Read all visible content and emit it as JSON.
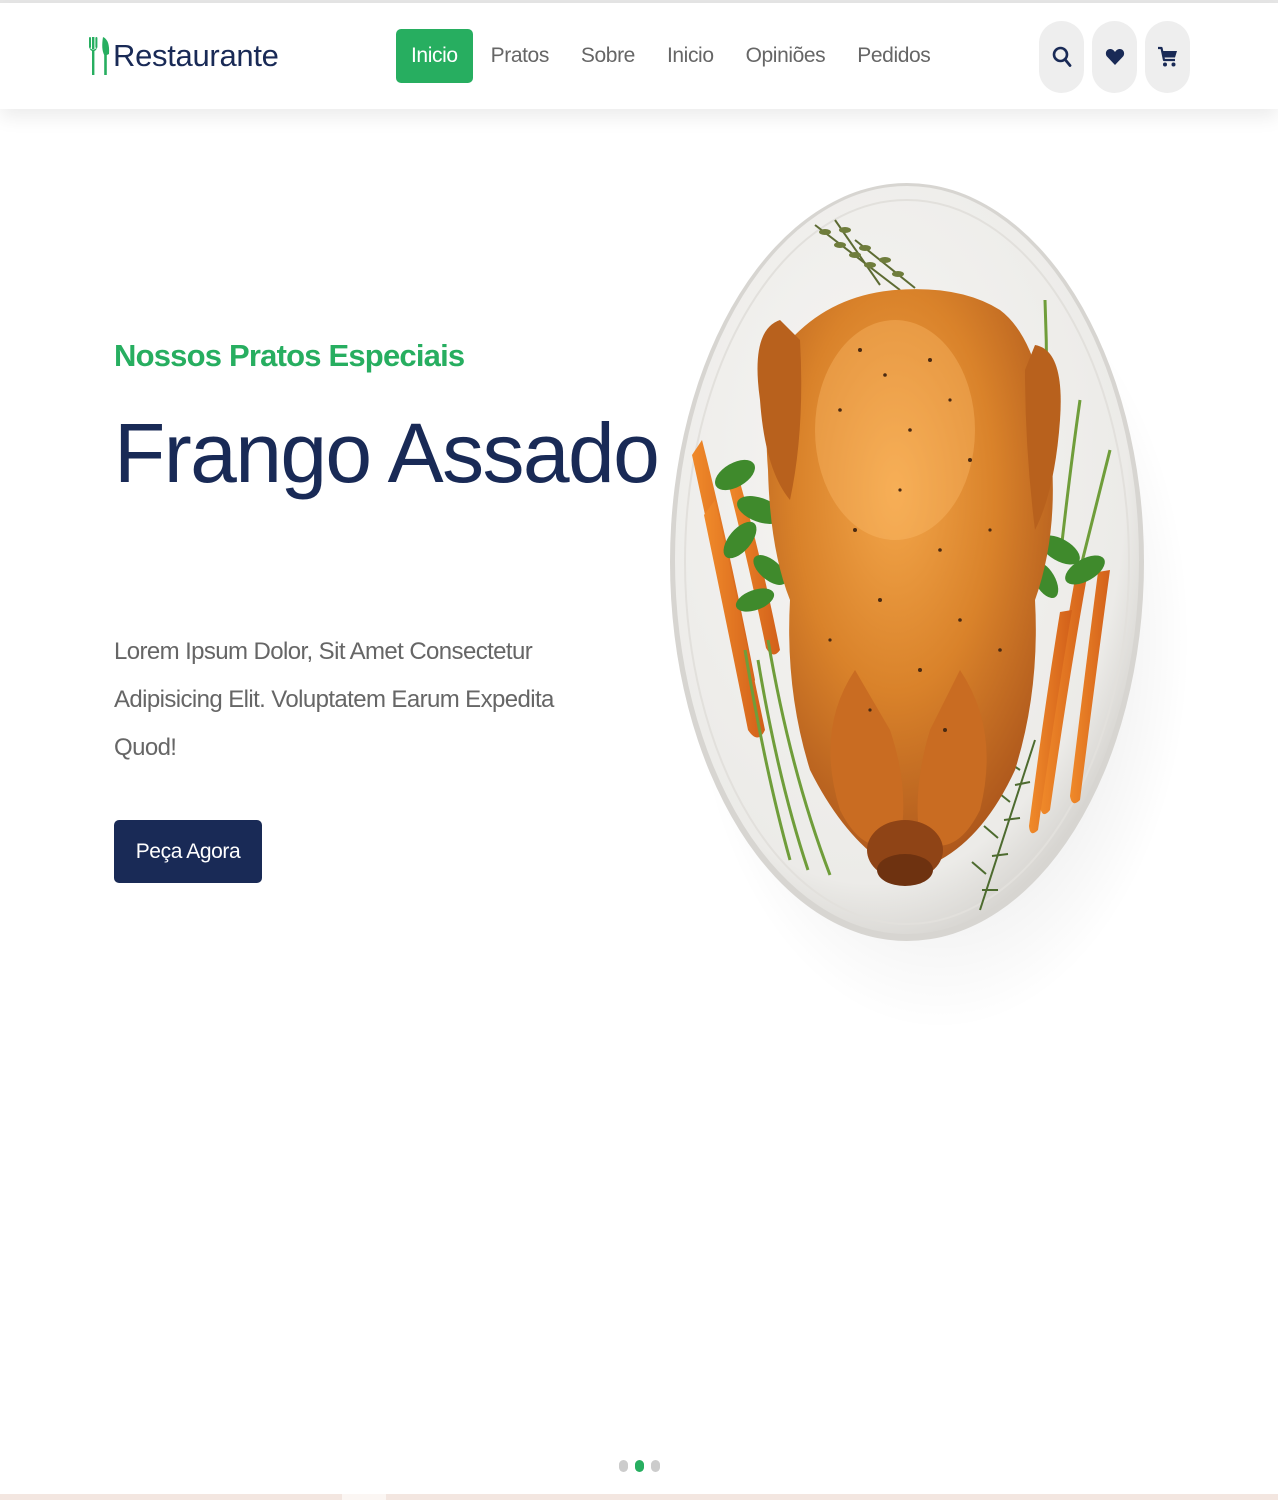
{
  "brand": {
    "name": "Restaurante",
    "icon": "utensils-icon"
  },
  "nav": {
    "items": [
      {
        "label": "Inicio",
        "active": true
      },
      {
        "label": "Pratos",
        "active": false
      },
      {
        "label": "Sobre",
        "active": false
      },
      {
        "label": "Inicio",
        "active": false
      },
      {
        "label": "Opiniões",
        "active": false
      },
      {
        "label": "Pedidos",
        "active": false
      }
    ]
  },
  "header_icons": [
    "search-icon",
    "heart-icon",
    "cart-icon"
  ],
  "hero": {
    "subtitle": "Nossos Pratos Especiais",
    "title": "Frango Assado",
    "description": "Lorem Ipsum Dolor, Sit Amet Consectetur Adipisicing Elit. Voluptatem Earum Expedita Quod!",
    "button_label": "Peça Agora",
    "image": "roast-chicken-plate"
  },
  "slider": {
    "total": 3,
    "active_index": 1
  },
  "colors": {
    "green": "#27ae60",
    "navy": "#192a56",
    "gray_text": "#666666",
    "icon_bg": "#eeeeee"
  }
}
